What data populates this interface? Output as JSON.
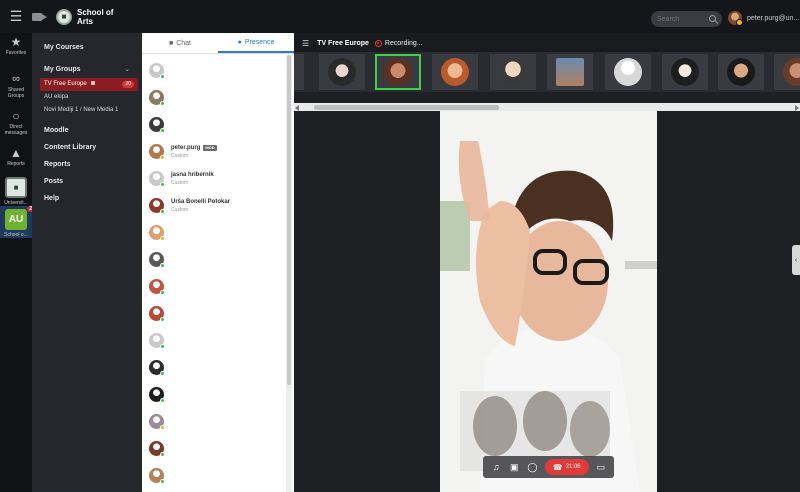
{
  "topbar": {
    "brand_name": "School of Arts",
    "search_placeholder": "Search",
    "user_name": "peter.purg@un..."
  },
  "rail": {
    "items": [
      {
        "label": "Favorites",
        "icon": "star-icon"
      },
      {
        "label": "Shared Groups",
        "icon": "link-icon"
      },
      {
        "label": "Direct messages",
        "icon": "chat-bubble-icon"
      },
      {
        "label": "Reports",
        "icon": "chart-icon"
      },
      {
        "label": "Universit...",
        "icon": "university-logo"
      },
      {
        "label": "School o...",
        "tile_text": "AU",
        "badge": "2"
      }
    ]
  },
  "nav": {
    "my_courses": "My Courses",
    "my_groups": "My Groups",
    "groups": [
      {
        "label": "TV Free Europe",
        "count": "20",
        "active": true
      },
      {
        "label": "AU ekipa"
      },
      {
        "label": "Novi Mediji 1 / New Media 1"
      }
    ],
    "moodle": "Moodle",
    "content_library": "Content Library",
    "reports": "Reports",
    "posts": "Posts",
    "help": "Help"
  },
  "side": {
    "tab_chat": "Chat",
    "tab_presence": "Presence",
    "presence": [
      {
        "name": "",
        "status": "",
        "avatar": "#c9c9c9",
        "dot": "#3fbf4a"
      },
      {
        "name": "",
        "status": "",
        "avatar": "#8a7a62",
        "dot": "#3fbf4a"
      },
      {
        "name": "",
        "status": "",
        "avatar": "#3a3a3a",
        "dot": "#3fbf4a"
      },
      {
        "name": "peter.purg",
        "badge": "MOD",
        "status": "Custom",
        "avatar": "#b07a50",
        "dot": "#f1b81c"
      },
      {
        "name": "jasna hribernik",
        "status": "Custom",
        "avatar": "#c9c9c9",
        "dot": "#3fbf4a"
      },
      {
        "name": "Urša Bonelli Potokar",
        "status": "Custom",
        "avatar": "#8c3a2a",
        "dot": "#3fbf4a"
      },
      {
        "name": "",
        "status": "",
        "avatar": "#d9a070",
        "dot": "#f1b81c"
      },
      {
        "name": "",
        "status": "",
        "avatar": "#5a5a5a",
        "dot": "#3fbf4a"
      },
      {
        "name": "",
        "status": "",
        "avatar": "#c2553f",
        "dot": "#3fbf4a"
      },
      {
        "name": "",
        "status": "",
        "avatar": "#b84a3a",
        "dot": "#3fbf4a"
      },
      {
        "name": "",
        "status": "",
        "avatar": "#c9c9c9",
        "dot": "#3fbf4a"
      },
      {
        "name": "",
        "status": "",
        "avatar": "#2d2d2d",
        "dot": "#3fbf4a"
      },
      {
        "name": "",
        "status": "",
        "avatar": "#1e1e1e",
        "dot": "#3fbf4a"
      },
      {
        "name": "",
        "status": "",
        "avatar": "#9a8aa0",
        "dot": "#f1b81c"
      },
      {
        "name": "",
        "status": "",
        "avatar": "#7a3a2a",
        "dot": "#3fbf4a"
      },
      {
        "name": "",
        "status": "",
        "avatar": "#b6805a",
        "dot": "#3fbf4a"
      }
    ]
  },
  "main": {
    "room_title": "TV Free Europe",
    "recording_label": "Recording...",
    "call_timer": "21:06"
  },
  "colors": {
    "accent_blue": "#2e7bd6",
    "active_group_red": "#8b1c22",
    "online_green": "#3fbf4a",
    "away_yellow": "#f1b81c",
    "hangup_red": "#e23a3a"
  }
}
